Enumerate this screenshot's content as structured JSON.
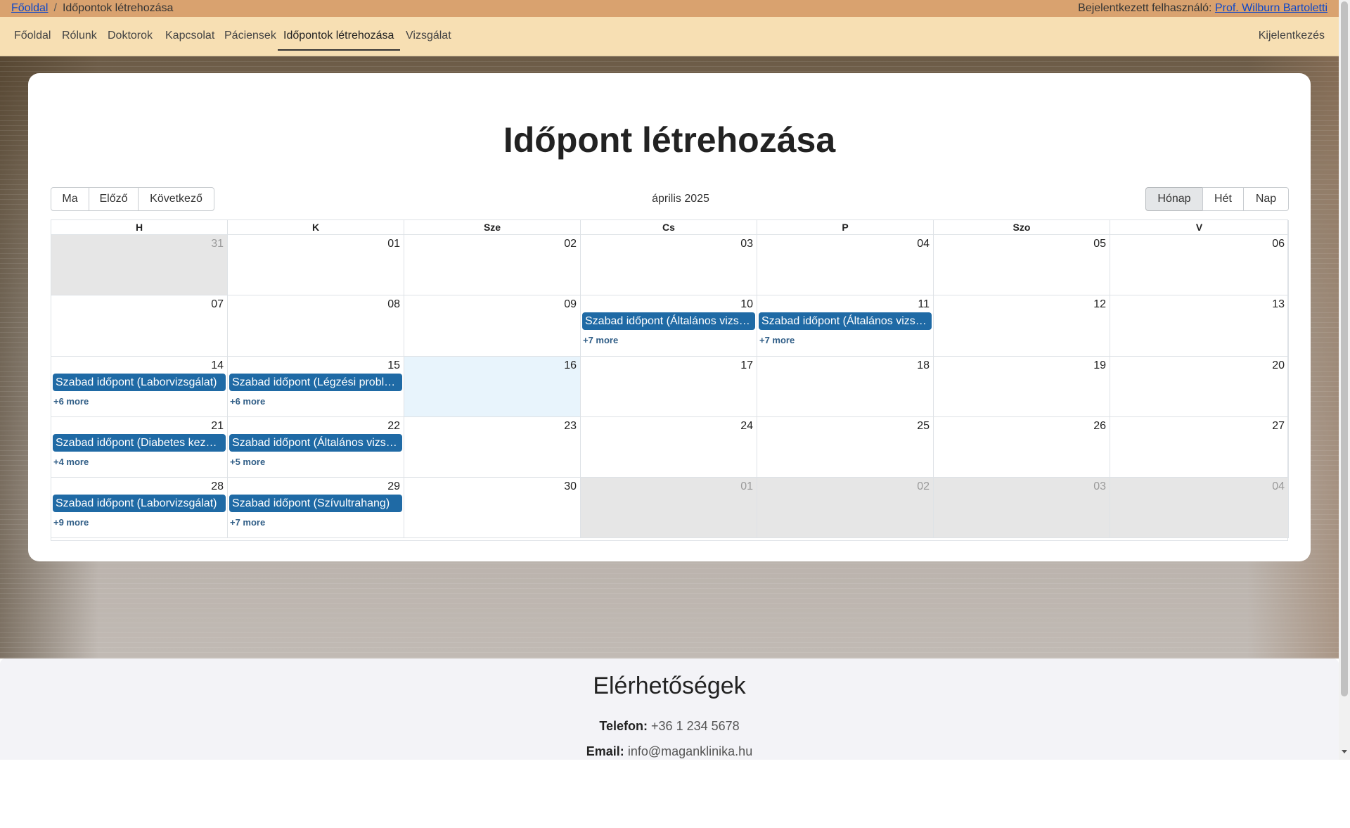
{
  "breadcrumb": {
    "home": "Főoldal",
    "separator": "/",
    "current": "Időpontok létrehozása"
  },
  "user": {
    "label": "Bejelentkezett felhasználó:",
    "name": "Prof. Wilburn Bartoletti"
  },
  "nav": {
    "items": [
      "Főoldal",
      "Rólunk",
      "Doktorok",
      "Kapcsolat",
      "Páciensek",
      "Időpontok létrehozása",
      "Vizsgálat"
    ],
    "active": "Időpontok létrehozása",
    "logout": "Kijelentkezés"
  },
  "page": {
    "title": "Időpont létrehozása"
  },
  "toolbar": {
    "today": "Ma",
    "prev": "Előző",
    "next": "Következő",
    "period": "április 2025",
    "views": [
      "Hónap",
      "Hét",
      "Nap"
    ],
    "active_view": "Hónap"
  },
  "calendar": {
    "weekdays": [
      "H",
      "K",
      "Sze",
      "Cs",
      "P",
      "Szo",
      "V"
    ],
    "weeks": [
      [
        {
          "day": "31",
          "other": true
        },
        {
          "day": "01"
        },
        {
          "day": "02"
        },
        {
          "day": "03"
        },
        {
          "day": "04"
        },
        {
          "day": "05"
        },
        {
          "day": "06"
        }
      ],
      [
        {
          "day": "07"
        },
        {
          "day": "08"
        },
        {
          "day": "09"
        },
        {
          "day": "10",
          "event": "Szabad időpont (Általános vizsgálat)",
          "more": "+7 more"
        },
        {
          "day": "11",
          "event": "Szabad időpont (Általános vizsgálat)",
          "more": "+7 more"
        },
        {
          "day": "12"
        },
        {
          "day": "13"
        }
      ],
      [
        {
          "day": "14",
          "event": "Szabad időpont (Laborvizsgálat)",
          "more": "+6 more"
        },
        {
          "day": "15",
          "event": "Szabad időpont (Légzési problémák)",
          "more": "+6 more"
        },
        {
          "day": "16",
          "today": true
        },
        {
          "day": "17"
        },
        {
          "day": "18"
        },
        {
          "day": "19"
        },
        {
          "day": "20"
        }
      ],
      [
        {
          "day": "21",
          "event": "Szabad időpont (Diabetes kezelés)",
          "more": "+4 more"
        },
        {
          "day": "22",
          "event": "Szabad időpont (Általános vizsgálat)",
          "more": "+5 more"
        },
        {
          "day": "23"
        },
        {
          "day": "24"
        },
        {
          "day": "25"
        },
        {
          "day": "26"
        },
        {
          "day": "27"
        }
      ],
      [
        {
          "day": "28",
          "event": "Szabad időpont (Laborvizsgálat)",
          "more": "+9 more"
        },
        {
          "day": "29",
          "event": "Szabad időpont (Szívultrahang)",
          "more": "+7 more"
        },
        {
          "day": "30"
        },
        {
          "day": "01",
          "other": true
        },
        {
          "day": "02",
          "other": true
        },
        {
          "day": "03",
          "other": true
        },
        {
          "day": "04",
          "other": true
        }
      ]
    ]
  },
  "contact": {
    "title": "Elérhetőségek",
    "phone_label": "Telefon:",
    "phone": "+36 1 234 5678",
    "email_label": "Email:",
    "email": "info@maganklinika.hu"
  },
  "colors": {
    "topbar": "#d9a26f",
    "navbar": "#f7dfb3",
    "event": "#1f6aa5",
    "link": "#0d47c9",
    "today": "#e8f4fc"
  }
}
